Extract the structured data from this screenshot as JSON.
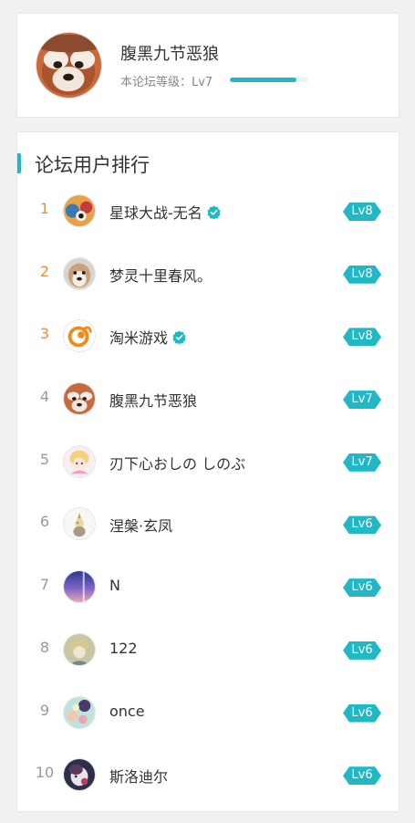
{
  "profile": {
    "username": "腹黑九节恶狼",
    "level_text": "本论坛等级：Lv7",
    "level_progress": 0.85,
    "avatar": "red-panda-avatar"
  },
  "ranking": {
    "title": "论坛用户排行",
    "users": [
      {
        "rank": "1",
        "name": "星球大战-无名",
        "verified": true,
        "level": "Lv8",
        "avatar": "star-wars-avatar"
      },
      {
        "rank": "2",
        "name": "梦灵十里春风。",
        "verified": false,
        "level": "Lv8",
        "avatar": "dog-avatar"
      },
      {
        "rank": "3",
        "name": "淘米游戏",
        "verified": true,
        "level": "Lv8",
        "avatar": "taomee-logo-avatar"
      },
      {
        "rank": "4",
        "name": "腹黑九节恶狼",
        "verified": false,
        "level": "Lv7",
        "avatar": "red-panda-avatar"
      },
      {
        "rank": "5",
        "name": "刃下心おしの しのぶ",
        "verified": false,
        "level": "Lv7",
        "avatar": "anime-girl-avatar"
      },
      {
        "rank": "6",
        "name": "涅槃·玄凤",
        "verified": false,
        "level": "Lv6",
        "avatar": "cockatiel-avatar"
      },
      {
        "rank": "7",
        "name": "N",
        "verified": false,
        "level": "Lv6",
        "avatar": "sky-avatar"
      },
      {
        "rank": "8",
        "name": "122",
        "verified": false,
        "level": "Lv6",
        "avatar": "anime-character-avatar"
      },
      {
        "rank": "9",
        "name": "once",
        "verified": false,
        "level": "Lv6",
        "avatar": "flowers-avatar"
      },
      {
        "rank": "10",
        "name": "斯洛迪尔",
        "verified": false,
        "level": "Lv6",
        "avatar": "dark-anime-avatar"
      }
    ]
  },
  "colors": {
    "accent": "#21b8c5",
    "top_rank": "#ef8f3a",
    "rank": "#999999"
  }
}
